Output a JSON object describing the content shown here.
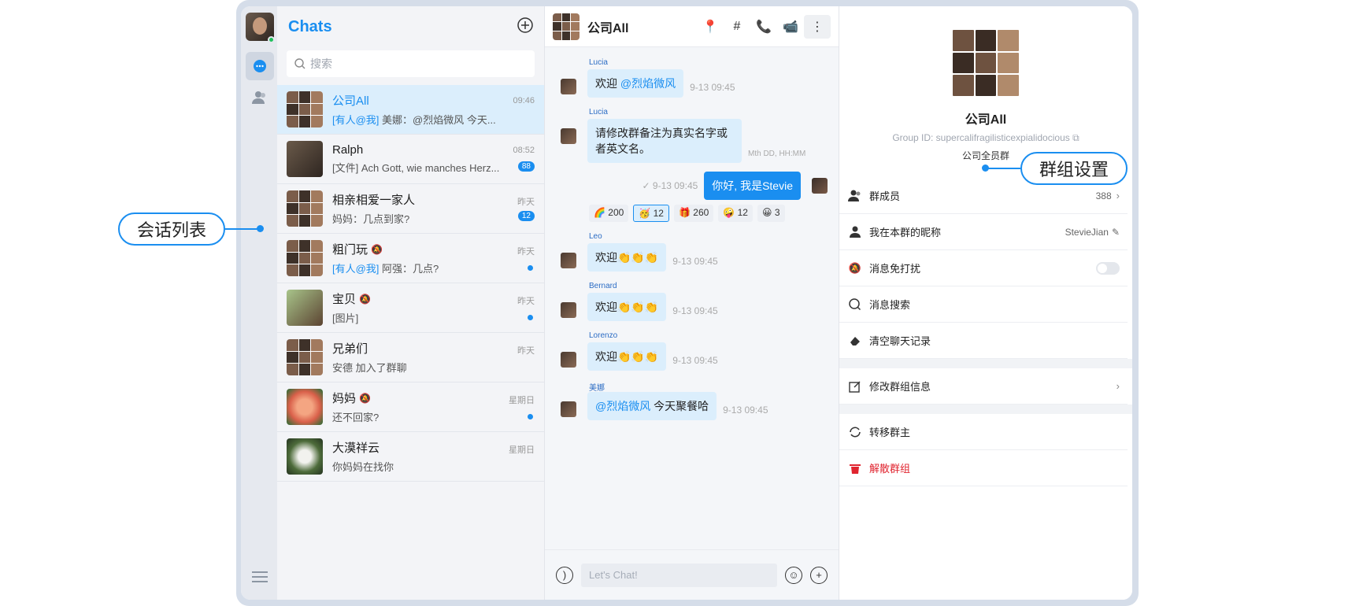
{
  "list": {
    "title": "Chats",
    "search_placeholder": "搜索",
    "conversations": [
      {
        "name": "公司All",
        "mention": "[有人@我]",
        "msg": " 美娜：@烈焰微风 今天...",
        "time": "09:46"
      },
      {
        "name": "Ralph",
        "mention": "",
        "msg": "[文件] Ach Gott, wie manches Herz...",
        "time": "08:52",
        "badge": "88"
      },
      {
        "name": "相亲相爱一家人",
        "mention": "",
        "msg": "妈妈：几点到家?",
        "time": "昨天",
        "badge": "12"
      },
      {
        "name": "粗门玩",
        "mention": "[有人@我]",
        "msg": " 阿强：几点?",
        "time": "昨天"
      },
      {
        "name": "宝贝",
        "mention": "",
        "msg": "[图片]",
        "time": "昨天"
      },
      {
        "name": "兄弟们",
        "mention": "",
        "msg": "安德 加入了群聊",
        "time": "昨天"
      },
      {
        "name": "妈妈",
        "mention": "",
        "msg": "还不回家?",
        "time": "星期日"
      },
      {
        "name": "大漠祥云",
        "mention": "",
        "msg": "你妈妈在找你",
        "time": "星期日"
      }
    ]
  },
  "chat": {
    "title": "公司All",
    "messages": [
      {
        "sender": "Lucia",
        "text": "欢迎 ",
        "mention": "@烈焰微风",
        "time": "9-13 09:45"
      },
      {
        "sender": "Lucia",
        "text": "请修改群备注为真实名字或者英文名。",
        "time": "Mth DD, HH:MM"
      },
      {
        "out_text": "你好, 我是Stevie",
        "out_time": "9-13 09:45"
      },
      {
        "sender": "Leo",
        "text": "欢迎👏👏👏",
        "time": "9-13 09:45"
      },
      {
        "sender": "Bernard",
        "text": "欢迎👏👏👏",
        "time": "9-13 09:45"
      },
      {
        "sender": "Lorenzo",
        "text": "欢迎👏👏👏",
        "time": "9-13 09:45"
      },
      {
        "sender": "美娜",
        "mention": "@烈焰微风",
        "text": " 今天聚餐哈",
        "time": "9-13 09:45"
      }
    ],
    "reactions": [
      {
        "emoji": "🌈",
        "count": "200"
      },
      {
        "emoji": "🥳",
        "count": "12"
      },
      {
        "emoji": "🎁",
        "count": "260"
      },
      {
        "emoji": "🤪",
        "count": "12"
      },
      {
        "emoji": "😀",
        "count": "3"
      }
    ],
    "input_placeholder": "Let's Chat!"
  },
  "info": {
    "group_name": "公司All",
    "group_id": "Group ID: supercalifragilisticexpialidocious",
    "group_desc": "公司全员群",
    "members_label": "群成员",
    "members_count": "388",
    "nickname_label": "我在本群的昵称",
    "nickname_value": "StevieJian",
    "mute_label": "消息免打扰",
    "search_label": "消息搜索",
    "clear_label": "清空聊天记录",
    "edit_label": "修改群组信息",
    "transfer_label": "转移群主",
    "dissolve_label": "解散群组"
  },
  "callouts": {
    "left": "会话列表",
    "right": "群组设置"
  }
}
